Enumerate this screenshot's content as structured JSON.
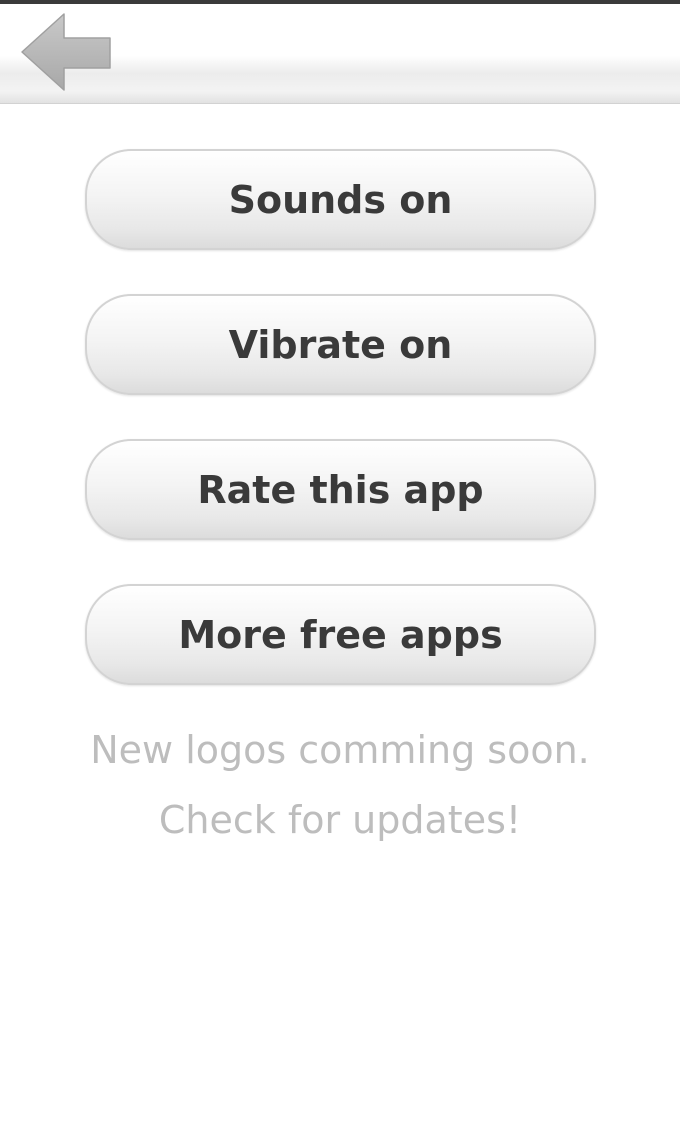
{
  "header": {
    "back_icon": "back-arrow-icon"
  },
  "menu": {
    "items": [
      {
        "label": "Sounds on"
      },
      {
        "label": "Vibrate on"
      },
      {
        "label": "Rate this app"
      },
      {
        "label": "More free apps"
      }
    ]
  },
  "notice": {
    "line1": "New logos comming soon.",
    "line2": "Check for updates!"
  },
  "colors": {
    "button_text": "#3a3a3a",
    "notice_text": "#bdbdbd",
    "icon_gray": "#b8b8b8"
  }
}
